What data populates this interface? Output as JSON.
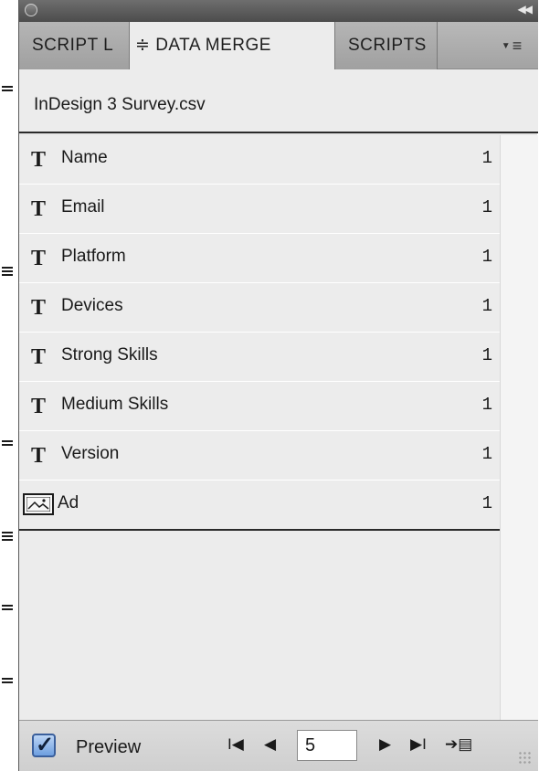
{
  "tabs": [
    {
      "label": "SCRIPT L"
    },
    {
      "label": "≑ DATA MERGE"
    },
    {
      "label": "SCRIPTS"
    }
  ],
  "menu_icon": "panel-menu-icon",
  "data_source": "InDesign 3 Survey.csv",
  "fields": [
    {
      "type_icon": "T",
      "name": "Name",
      "count": "1"
    },
    {
      "type_icon": "T",
      "name": "Email",
      "count": "1"
    },
    {
      "type_icon": "T",
      "name": "Platform",
      "count": "1"
    },
    {
      "type_icon": "T",
      "name": "Devices",
      "count": "1"
    },
    {
      "type_icon": "T",
      "name": "Strong Skills",
      "count": "1"
    },
    {
      "type_icon": "T",
      "name": "Medium Skills",
      "count": "1"
    },
    {
      "type_icon": "T",
      "name": "Version",
      "count": "1"
    },
    {
      "type_icon": "image-field-icon",
      "name": "Ad",
      "count": "1"
    }
  ],
  "footer": {
    "preview_label": "Preview",
    "preview_checked": true,
    "first_glyph": "I◀",
    "prev_glyph": "◀",
    "record": "5",
    "next_glyph": "▶",
    "last_glyph": "▶I",
    "create_glyph": "➔▤"
  },
  "colors": {
    "panel_bg": "#e6e6e6",
    "guide": "#b0389c",
    "checkbox": "#6e9fe0"
  }
}
